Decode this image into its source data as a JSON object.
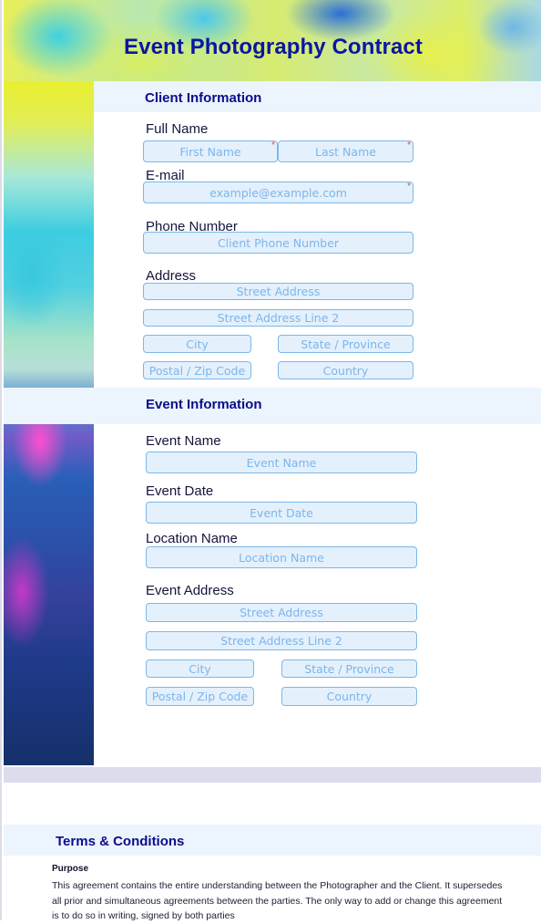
{
  "header": {
    "title": "Event Photography Contract"
  },
  "client_section": {
    "title": "Client Information",
    "full_name": {
      "label": "Full Name",
      "first_placeholder": "First Name",
      "last_placeholder": "Last Name",
      "required_mark": "*"
    },
    "email": {
      "label": "E-mail",
      "placeholder": "example@example.com",
      "required_mark": "*"
    },
    "phone": {
      "label": "Phone Number",
      "placeholder": "Client Phone Number"
    },
    "address": {
      "label": "Address",
      "street": "Street Address",
      "street2": "Street Address Line 2",
      "city": "City",
      "state": "State / Province",
      "postal": "Postal / Zip Code",
      "country": "Country"
    }
  },
  "event_section": {
    "title": "Event Information",
    "event_name": {
      "label": "Event Name",
      "placeholder": "Event Name"
    },
    "event_date": {
      "label": "Event Date",
      "placeholder": "Event Date"
    },
    "location_name": {
      "label": "Location Name",
      "placeholder": "Location Name"
    },
    "event_address": {
      "label": "Event Address",
      "street": "Street Address",
      "street2": "Street Address Line 2",
      "city": "City",
      "state": "State / Province",
      "postal": "Postal / Zip Code",
      "country": "Country"
    }
  },
  "terms_section": {
    "title": "Terms & Conditions",
    "purpose_heading": "Purpose",
    "purpose_text": "This agreement contains the entire understanding between the Photographer and the Client. It supersedes all prior and simultaneous agreements between the parties. The only way to add or change this agreement is to do so in writing, signed by both parties"
  },
  "colors": {
    "title": "#0b16a0",
    "section_title": "#0b0e8a",
    "section_band": "#ecf4fe",
    "input_bg": "#e4f0fc",
    "input_border": "#7ab8ea",
    "placeholder": "#7bb6ec",
    "required": "#e84242"
  }
}
